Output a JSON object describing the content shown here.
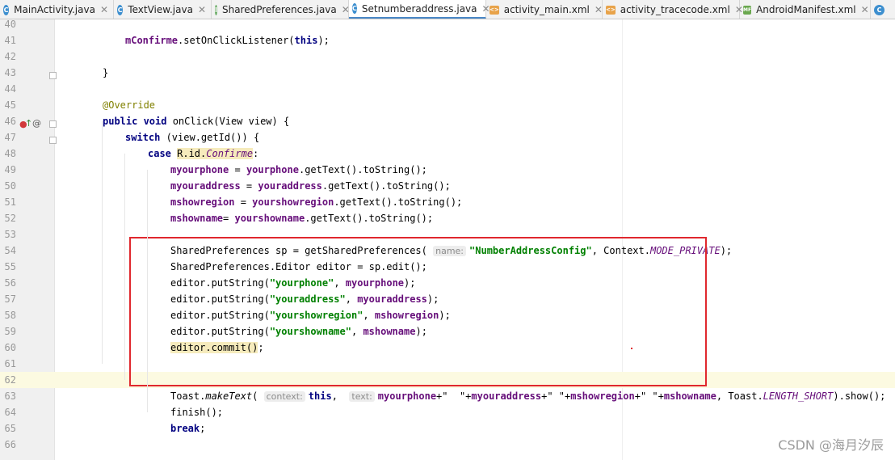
{
  "tabs": [
    {
      "label": "MainActivity.java",
      "icon": "java-class-icon",
      "glyph": "C",
      "active": false
    },
    {
      "label": "TextView.java",
      "icon": "java-class-icon",
      "glyph": "C",
      "active": false
    },
    {
      "label": "SharedPreferences.java",
      "icon": "java-interface-icon",
      "glyph": "I",
      "active": false
    },
    {
      "label": "Setnumberaddress.java",
      "icon": "java-class-icon",
      "glyph": "C",
      "active": true
    },
    {
      "label": "activity_main.xml",
      "icon": "xml-icon",
      "glyph": "<>",
      "active": false
    },
    {
      "label": "activity_tracecode.xml",
      "icon": "xml-icon",
      "glyph": "<>",
      "active": false
    },
    {
      "label": "AndroidManifest.xml",
      "icon": "manifest-icon",
      "glyph": "MF",
      "active": false
    },
    {
      "label": "",
      "icon": "java-class-icon",
      "glyph": "C",
      "active": false
    }
  ],
  "lines": [
    {
      "n": "40",
      "segs": []
    },
    {
      "n": "41",
      "segs": [
        [
          "fld",
          "mConfirme"
        ],
        [
          "",
          ".setOnClickListener("
        ],
        [
          "kw",
          "this"
        ],
        [
          "",
          ");"
        ]
      ]
    },
    {
      "n": "42",
      "segs": []
    },
    {
      "n": "43",
      "segs": [
        [
          "",
          "}"
        ]
      ]
    },
    {
      "n": "44",
      "segs": []
    },
    {
      "n": "45",
      "segs": [
        [
          "ann",
          "@Override"
        ]
      ]
    },
    {
      "n": "46",
      "segs": [
        [
          "kw",
          "public void "
        ],
        [
          "",
          "onClick(View view) {"
        ]
      ]
    },
    {
      "n": "47",
      "segs": [
        [
          "kw",
          "switch "
        ],
        [
          "",
          "(view.getId()) {"
        ]
      ]
    },
    {
      "n": "48",
      "segs": [
        [
          "kw",
          "case "
        ],
        [
          "hl",
          "R.id."
        ],
        [
          "hl sconst",
          "Confirme"
        ],
        [
          "",
          ":"
        ]
      ]
    },
    {
      "n": "49",
      "segs": [
        [
          "fld",
          "myourphone"
        ],
        [
          "",
          " = "
        ],
        [
          "fld",
          "yourphone"
        ],
        [
          "",
          ".getText().toString();"
        ]
      ]
    },
    {
      "n": "50",
      "segs": [
        [
          "fld",
          "myouraddress"
        ],
        [
          "",
          " = "
        ],
        [
          "fld",
          "youraddress"
        ],
        [
          "",
          ".getText().toString();"
        ]
      ]
    },
    {
      "n": "51",
      "segs": [
        [
          "fld",
          "mshowregion"
        ],
        [
          "",
          " = "
        ],
        [
          "fld",
          "yourshowregion"
        ],
        [
          "",
          ".getText().toString();"
        ]
      ]
    },
    {
      "n": "52",
      "segs": [
        [
          "fld",
          "mshowname"
        ],
        [
          "",
          "= "
        ],
        [
          "fld",
          "yourshowname"
        ],
        [
          "",
          ".getText().toString();"
        ]
      ]
    },
    {
      "n": "53",
      "segs": []
    },
    {
      "n": "54",
      "segs": [
        [
          "",
          "SharedPreferences sp = getSharedPreferences( "
        ],
        [
          "hint",
          "name:"
        ],
        [
          "str",
          "\"NumberAddressConfig\""
        ],
        [
          "",
          ", Context."
        ],
        [
          "sconst",
          "MODE_PRIVATE"
        ],
        [
          "",
          ");"
        ]
      ]
    },
    {
      "n": "55",
      "segs": [
        [
          "",
          "SharedPreferences.Editor editor = sp.edit();"
        ]
      ]
    },
    {
      "n": "56",
      "segs": [
        [
          "",
          "editor.putString("
        ],
        [
          "str",
          "\"yourphone\""
        ],
        [
          "",
          ", "
        ],
        [
          "fld",
          "myourphone"
        ],
        [
          "",
          ");"
        ]
      ]
    },
    {
      "n": "57",
      "segs": [
        [
          "",
          "editor.putString("
        ],
        [
          "str",
          "\"youraddress\""
        ],
        [
          "",
          ", "
        ],
        [
          "fld",
          "myouraddress"
        ],
        [
          "",
          ");"
        ]
      ]
    },
    {
      "n": "58",
      "segs": [
        [
          "",
          "editor.putString("
        ],
        [
          "str",
          "\"yourshowregion\""
        ],
        [
          "",
          ", "
        ],
        [
          "fld",
          "mshowregion"
        ],
        [
          "",
          ");"
        ]
      ]
    },
    {
      "n": "59",
      "segs": [
        [
          "",
          "editor.putString("
        ],
        [
          "str",
          "\"yourshowname\""
        ],
        [
          "",
          ", "
        ],
        [
          "fld",
          "mshowname"
        ],
        [
          "",
          ");"
        ]
      ]
    },
    {
      "n": "60",
      "segs": [
        [
          "hl",
          "editor.commit()"
        ],
        [
          "",
          ";"
        ]
      ]
    },
    {
      "n": "61",
      "segs": []
    },
    {
      "n": "62",
      "segs": []
    },
    {
      "n": "63",
      "segs": [
        [
          "",
          "Toast."
        ],
        [
          "ital",
          "makeText"
        ],
        [
          "",
          "( "
        ],
        [
          "hint",
          "context:"
        ],
        [
          "kw",
          "this"
        ],
        [
          "",
          ",  "
        ],
        [
          "hint",
          "text:"
        ],
        [
          "fld",
          "myourphone"
        ],
        [
          "",
          "+\"  \"+"
        ],
        [
          "fld",
          "myouraddress"
        ],
        [
          "",
          "+\" \"+"
        ],
        [
          "fld",
          "mshowregion"
        ],
        [
          "",
          "+\" \"+"
        ],
        [
          "fld",
          "mshowname"
        ],
        [
          "",
          ", Toast."
        ],
        [
          "sconst",
          "LENGTH_SHORT"
        ],
        [
          "",
          ").show();"
        ]
      ]
    },
    {
      "n": "64",
      "segs": [
        [
          "",
          "finish();"
        ]
      ]
    },
    {
      "n": "65",
      "segs": [
        [
          "kw",
          "break"
        ],
        [
          "",
          ";"
        ]
      ]
    },
    {
      "n": "66",
      "segs": []
    }
  ],
  "watermark": "CSDN @海月汐辰"
}
